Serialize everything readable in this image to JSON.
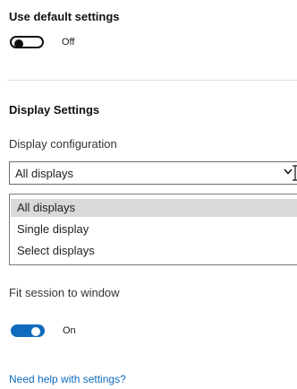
{
  "default_settings": {
    "title": "Use default settings",
    "toggle_state": "Off"
  },
  "display_settings": {
    "title": "Display Settings",
    "config_label": "Display configuration",
    "selected_value": "All displays",
    "options": [
      {
        "label": "All displays",
        "highlighted": true
      },
      {
        "label": "Single display",
        "highlighted": false
      },
      {
        "label": "Select displays",
        "highlighted": false
      }
    ]
  },
  "fit_session": {
    "label": "Fit session to window",
    "toggle_state": "On"
  },
  "help": {
    "link_label": "Need help with settings?"
  },
  "colors": {
    "accent": "#0f6cbd",
    "selected_option_bg": "#d9d9d9"
  },
  "icons": {
    "dropdown": "chevron-down-icon",
    "cursor": "text-cursor-icon"
  }
}
